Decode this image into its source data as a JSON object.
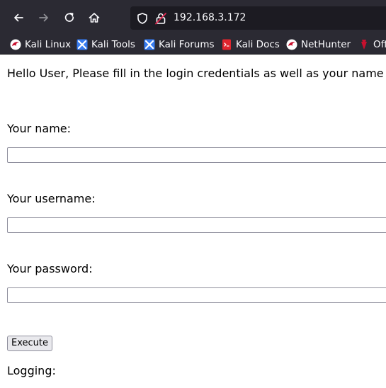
{
  "browser": {
    "url": "192.168.3.172",
    "accent_color": "#2b2a33",
    "urlbar_color": "#1c1b22",
    "buttons": {
      "back": "arrow-left-icon",
      "forward": "arrow-right-icon",
      "reload": "reload-icon",
      "home": "home-icon"
    }
  },
  "bookmarks": [
    {
      "label": "Kali Linux",
      "icon": "kali-dragon-icon"
    },
    {
      "label": "Kali Tools",
      "icon": "kali-tools-icon"
    },
    {
      "label": "Kali Forums",
      "icon": "kali-forums-icon"
    },
    {
      "label": "Kali Docs",
      "icon": "kali-docs-icon"
    },
    {
      "label": "NetHunter",
      "icon": "nethunter-icon"
    },
    {
      "label": "Off",
      "icon": "offsec-icon"
    }
  ],
  "page": {
    "intro": "Hello User, Please fill in the login credentials as well as your name for",
    "name_label": "Your name:",
    "name_value": "",
    "username_label": "Your username:",
    "username_value": "",
    "password_label": "Your password:",
    "password_value": "",
    "execute_label": "Execute",
    "logging_label": "Logging:"
  }
}
